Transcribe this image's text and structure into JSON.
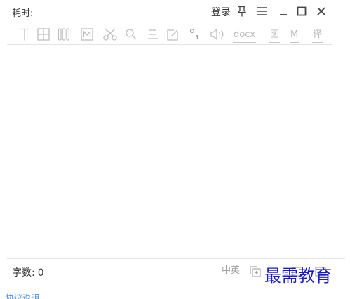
{
  "titlebar": {
    "elapsed_label": "耗时:",
    "login_label": "登录",
    "pin_icon": "pin-icon",
    "menu_icon": "menu-icon",
    "minimize_icon": "minimize-icon",
    "maximize_icon": "maximize-icon",
    "close_icon": "close-icon"
  },
  "toolbar": {
    "icons": [
      "text-cursor-icon",
      "grid-icon",
      "columns-icon",
      "m-box-icon",
      "scissors-icon",
      "search-icon",
      "align-lines-icon",
      "edit-box-icon",
      "degree-comma-icon",
      "speaker-icon"
    ],
    "docx_label": "docx",
    "image_label": "图",
    "m_label": "M",
    "translate_label": "译"
  },
  "status": {
    "word_count_label": "字数:",
    "word_count_value": "0",
    "lang_label": "中英"
  },
  "watermark": "最需教育",
  "footer_link": "协议说明",
  "colors": {
    "icon_gray": "#bdbdbd",
    "text_dark": "#333333",
    "watermark_blue": "#1a1acc",
    "link_blue": "#4a90e2"
  }
}
